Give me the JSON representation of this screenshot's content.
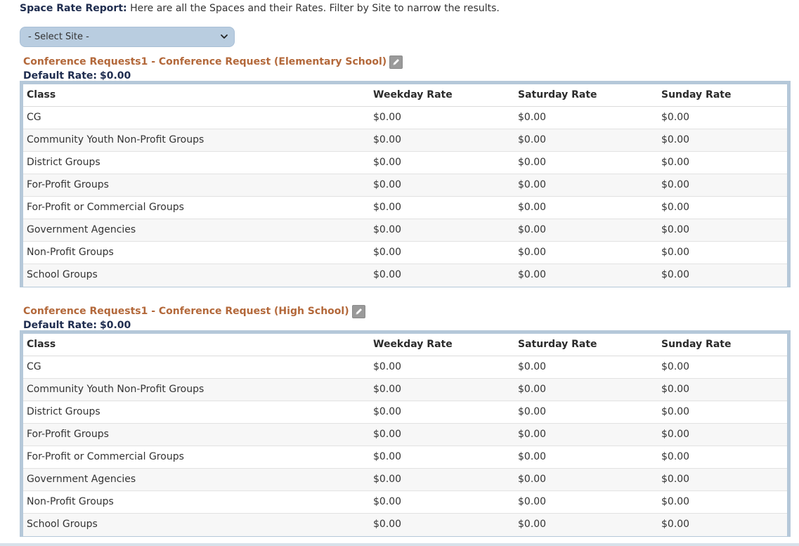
{
  "header": {
    "title": "Space Rate Report:",
    "description": "Here are all the Spaces and their Rates. Filter by Site to narrow the results."
  },
  "site_filter": {
    "selected": "- Select Site -"
  },
  "columns": {
    "class": "Class",
    "weekday": "Weekday Rate",
    "saturday": "Saturday Rate",
    "sunday": "Sunday Rate"
  },
  "spaces": [
    {
      "title": "Conference Requests1 - Conference Request (Elementary School)",
      "default_rate_label": "Default Rate:",
      "default_rate_value": "$0.00",
      "rows": [
        {
          "class": "CG",
          "weekday": "$0.00",
          "saturday": "$0.00",
          "sunday": "$0.00"
        },
        {
          "class": "Community Youth Non-Profit Groups",
          "weekday": "$0.00",
          "saturday": "$0.00",
          "sunday": "$0.00"
        },
        {
          "class": "District Groups",
          "weekday": "$0.00",
          "saturday": "$0.00",
          "sunday": "$0.00"
        },
        {
          "class": "For-Profit Groups",
          "weekday": "$0.00",
          "saturday": "$0.00",
          "sunday": "$0.00"
        },
        {
          "class": "For-Profit or Commercial Groups",
          "weekday": "$0.00",
          "saturday": "$0.00",
          "sunday": "$0.00"
        },
        {
          "class": "Government Agencies",
          "weekday": "$0.00",
          "saturday": "$0.00",
          "sunday": "$0.00"
        },
        {
          "class": "Non-Profit Groups",
          "weekday": "$0.00",
          "saturday": "$0.00",
          "sunday": "$0.00"
        },
        {
          "class": "School Groups",
          "weekday": "$0.00",
          "saturday": "$0.00",
          "sunday": "$0.00"
        }
      ]
    },
    {
      "title": "Conference Requests1 - Conference Request (High School)",
      "default_rate_label": "Default Rate:",
      "default_rate_value": "$0.00",
      "rows": [
        {
          "class": "CG",
          "weekday": "$0.00",
          "saturday": "$0.00",
          "sunday": "$0.00"
        },
        {
          "class": "Community Youth Non-Profit Groups",
          "weekday": "$0.00",
          "saturday": "$0.00",
          "sunday": "$0.00"
        },
        {
          "class": "District Groups",
          "weekday": "$0.00",
          "saturday": "$0.00",
          "sunday": "$0.00"
        },
        {
          "class": "For-Profit Groups",
          "weekday": "$0.00",
          "saturday": "$0.00",
          "sunday": "$0.00"
        },
        {
          "class": "For-Profit or Commercial Groups",
          "weekday": "$0.00",
          "saturday": "$0.00",
          "sunday": "$0.00"
        },
        {
          "class": "Government Agencies",
          "weekday": "$0.00",
          "saturday": "$0.00",
          "sunday": "$0.00"
        },
        {
          "class": "Non-Profit Groups",
          "weekday": "$0.00",
          "saturday": "$0.00",
          "sunday": "$0.00"
        },
        {
          "class": "School Groups",
          "weekday": "$0.00",
          "saturday": "$0.00",
          "sunday": "$0.00"
        }
      ]
    }
  ],
  "icons": {
    "edit": "pencil-icon",
    "dropdown": "chevron-down-icon"
  },
  "colors": {
    "space_title": "#b3683a",
    "heading": "#1f2d4f",
    "table_border": "#b5c8d9",
    "select_bg": "#b9cde0"
  }
}
